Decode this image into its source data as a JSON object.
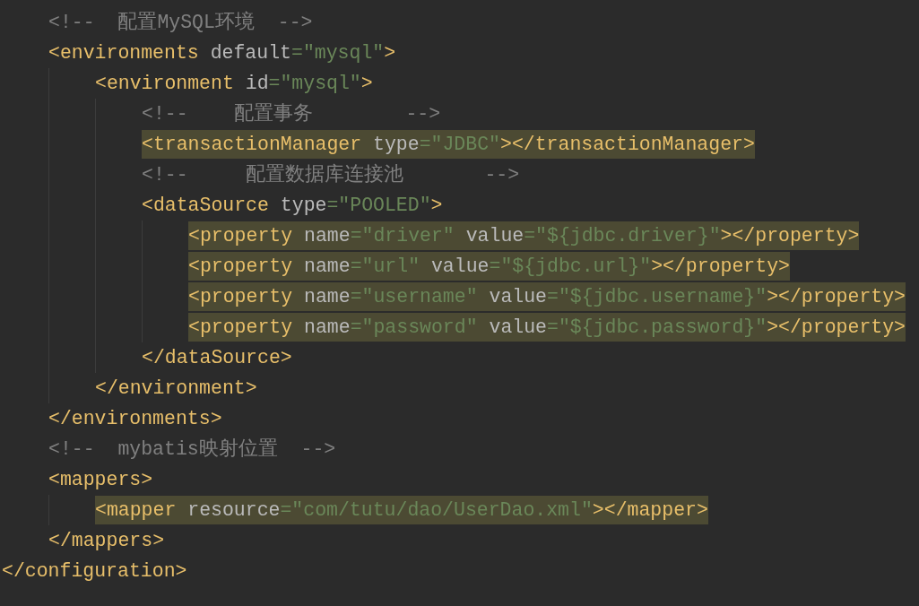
{
  "code": {
    "children": [
      {
        "text": "<!--  配置MySQL环境  -->",
        "highlighted": false
      },
      {
        "text": "<environments default=\"mysql\">",
        "highlighted": false,
        "children": [
          {
            "text": "<environment id=\"mysql\">",
            "highlighted": false,
            "children": [
              {
                "text": "<!--    配置事务        -->",
                "highlighted": false
              },
              {
                "text": "<transactionManager type=\"JDBC\"></transactionManager>",
                "highlighted": true
              },
              {
                "text": "<!--     配置数据库连接池       -->",
                "highlighted": false
              },
              {
                "text": "<dataSource type=\"POOLED\">",
                "highlighted": false,
                "children": [
                  {
                    "text": "<property name=\"driver\" value=\"${jdbc.driver}\"></property>",
                    "highlighted": true
                  },
                  {
                    "text": "<property name=\"url\" value=\"${jdbc.url}\"></property>",
                    "highlighted": true
                  },
                  {
                    "text": "<property name=\"username\" value=\"${jdbc.username}\"></property>",
                    "highlighted": true
                  },
                  {
                    "text": "<property name=\"password\" value=\"${jdbc.password}\"></property>",
                    "highlighted": true
                  }
                ]
              },
              {
                "text": "</dataSource>",
                "highlighted": false
              }
            ]
          },
          {
            "text": "</environment>",
            "highlighted": false
          }
        ]
      },
      {
        "text": "</environments>",
        "highlighted": false
      },
      {
        "text": "<!--  mybatis映射位置  -->",
        "highlighted": false
      },
      {
        "text": "<mappers>",
        "highlighted": false,
        "children": [
          {
            "text": "<mapper resource=\"com/tutu/dao/UserDao.xml\"></mapper>",
            "highlighted": true
          }
        ]
      },
      {
        "text": "</mappers>",
        "highlighted": false
      }
    ]
  },
  "closing_line": {
    "text": "</configuration>",
    "highlighted": false
  }
}
